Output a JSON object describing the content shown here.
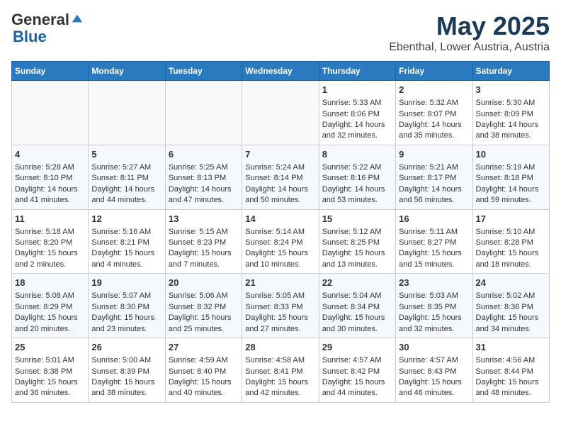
{
  "header": {
    "logo_general": "General",
    "logo_blue": "Blue",
    "title": "May 2025",
    "subtitle": "Ebenthal, Lower Austria, Austria"
  },
  "days_of_week": [
    "Sunday",
    "Monday",
    "Tuesday",
    "Wednesday",
    "Thursday",
    "Friday",
    "Saturday"
  ],
  "weeks": [
    [
      {
        "day": "",
        "info": ""
      },
      {
        "day": "",
        "info": ""
      },
      {
        "day": "",
        "info": ""
      },
      {
        "day": "",
        "info": ""
      },
      {
        "day": "1",
        "info": "Sunrise: 5:33 AM\nSunset: 8:06 PM\nDaylight: 14 hours\nand 32 minutes."
      },
      {
        "day": "2",
        "info": "Sunrise: 5:32 AM\nSunset: 8:07 PM\nDaylight: 14 hours\nand 35 minutes."
      },
      {
        "day": "3",
        "info": "Sunrise: 5:30 AM\nSunset: 8:09 PM\nDaylight: 14 hours\nand 38 minutes."
      }
    ],
    [
      {
        "day": "4",
        "info": "Sunrise: 5:28 AM\nSunset: 8:10 PM\nDaylight: 14 hours\nand 41 minutes."
      },
      {
        "day": "5",
        "info": "Sunrise: 5:27 AM\nSunset: 8:11 PM\nDaylight: 14 hours\nand 44 minutes."
      },
      {
        "day": "6",
        "info": "Sunrise: 5:25 AM\nSunset: 8:13 PM\nDaylight: 14 hours\nand 47 minutes."
      },
      {
        "day": "7",
        "info": "Sunrise: 5:24 AM\nSunset: 8:14 PM\nDaylight: 14 hours\nand 50 minutes."
      },
      {
        "day": "8",
        "info": "Sunrise: 5:22 AM\nSunset: 8:16 PM\nDaylight: 14 hours\nand 53 minutes."
      },
      {
        "day": "9",
        "info": "Sunrise: 5:21 AM\nSunset: 8:17 PM\nDaylight: 14 hours\nand 56 minutes."
      },
      {
        "day": "10",
        "info": "Sunrise: 5:19 AM\nSunset: 8:18 PM\nDaylight: 14 hours\nand 59 minutes."
      }
    ],
    [
      {
        "day": "11",
        "info": "Sunrise: 5:18 AM\nSunset: 8:20 PM\nDaylight: 15 hours\nand 2 minutes."
      },
      {
        "day": "12",
        "info": "Sunrise: 5:16 AM\nSunset: 8:21 PM\nDaylight: 15 hours\nand 4 minutes."
      },
      {
        "day": "13",
        "info": "Sunrise: 5:15 AM\nSunset: 8:23 PM\nDaylight: 15 hours\nand 7 minutes."
      },
      {
        "day": "14",
        "info": "Sunrise: 5:14 AM\nSunset: 8:24 PM\nDaylight: 15 hours\nand 10 minutes."
      },
      {
        "day": "15",
        "info": "Sunrise: 5:12 AM\nSunset: 8:25 PM\nDaylight: 15 hours\nand 13 minutes."
      },
      {
        "day": "16",
        "info": "Sunrise: 5:11 AM\nSunset: 8:27 PM\nDaylight: 15 hours\nand 15 minutes."
      },
      {
        "day": "17",
        "info": "Sunrise: 5:10 AM\nSunset: 8:28 PM\nDaylight: 15 hours\nand 18 minutes."
      }
    ],
    [
      {
        "day": "18",
        "info": "Sunrise: 5:08 AM\nSunset: 8:29 PM\nDaylight: 15 hours\nand 20 minutes."
      },
      {
        "day": "19",
        "info": "Sunrise: 5:07 AM\nSunset: 8:30 PM\nDaylight: 15 hours\nand 23 minutes."
      },
      {
        "day": "20",
        "info": "Sunrise: 5:06 AM\nSunset: 8:32 PM\nDaylight: 15 hours\nand 25 minutes."
      },
      {
        "day": "21",
        "info": "Sunrise: 5:05 AM\nSunset: 8:33 PM\nDaylight: 15 hours\nand 27 minutes."
      },
      {
        "day": "22",
        "info": "Sunrise: 5:04 AM\nSunset: 8:34 PM\nDaylight: 15 hours\nand 30 minutes."
      },
      {
        "day": "23",
        "info": "Sunrise: 5:03 AM\nSunset: 8:35 PM\nDaylight: 15 hours\nand 32 minutes."
      },
      {
        "day": "24",
        "info": "Sunrise: 5:02 AM\nSunset: 8:36 PM\nDaylight: 15 hours\nand 34 minutes."
      }
    ],
    [
      {
        "day": "25",
        "info": "Sunrise: 5:01 AM\nSunset: 8:38 PM\nDaylight: 15 hours\nand 36 minutes."
      },
      {
        "day": "26",
        "info": "Sunrise: 5:00 AM\nSunset: 8:39 PM\nDaylight: 15 hours\nand 38 minutes."
      },
      {
        "day": "27",
        "info": "Sunrise: 4:59 AM\nSunset: 8:40 PM\nDaylight: 15 hours\nand 40 minutes."
      },
      {
        "day": "28",
        "info": "Sunrise: 4:58 AM\nSunset: 8:41 PM\nDaylight: 15 hours\nand 42 minutes."
      },
      {
        "day": "29",
        "info": "Sunrise: 4:57 AM\nSunset: 8:42 PM\nDaylight: 15 hours\nand 44 minutes."
      },
      {
        "day": "30",
        "info": "Sunrise: 4:57 AM\nSunset: 8:43 PM\nDaylight: 15 hours\nand 46 minutes."
      },
      {
        "day": "31",
        "info": "Sunrise: 4:56 AM\nSunset: 8:44 PM\nDaylight: 15 hours\nand 48 minutes."
      }
    ]
  ]
}
